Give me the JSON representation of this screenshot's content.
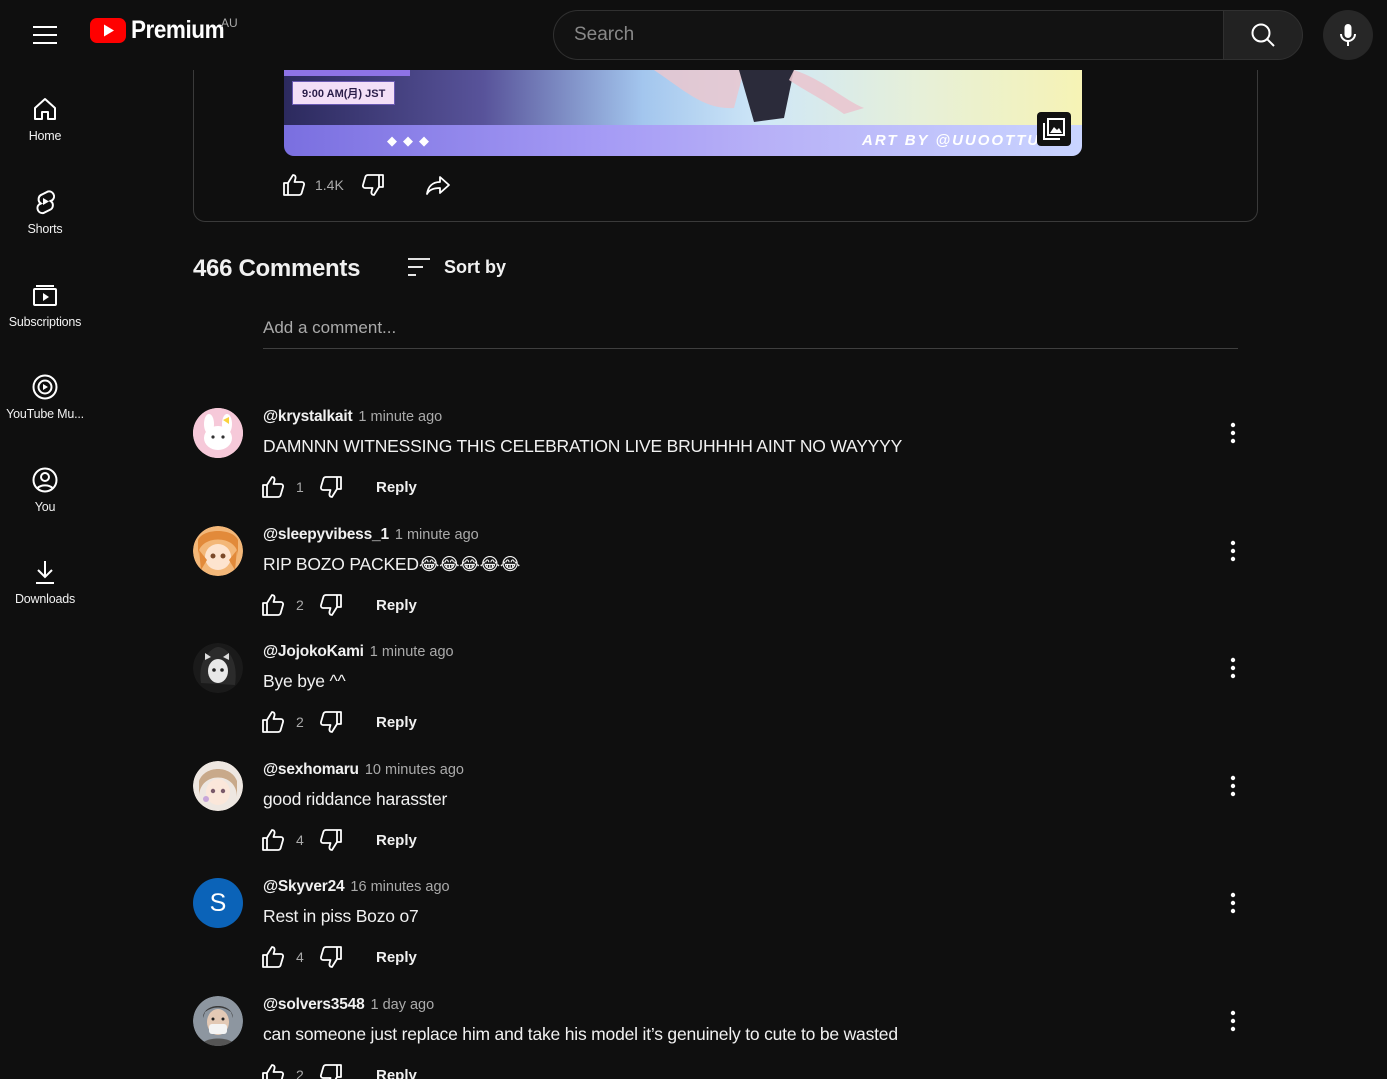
{
  "header": {
    "logo_text": "Premium",
    "region": "AU",
    "search_placeholder": "Search"
  },
  "sidebar": {
    "items": [
      {
        "label": "Home",
        "icon": "home-icon"
      },
      {
        "label": "Shorts",
        "icon": "shorts-icon"
      },
      {
        "label": "Subscriptions",
        "icon": "subscriptions-icon"
      },
      {
        "label": "YouTube Mu...",
        "icon": "youtube-music-icon"
      },
      {
        "label": "You",
        "icon": "account-icon"
      },
      {
        "label": "Downloads",
        "icon": "download-icon"
      }
    ]
  },
  "post": {
    "image_time_tag": "9:00 AM(月) JST",
    "image_art_credit": "ART BY @UUOOTTUU",
    "like_count": "1.4K"
  },
  "comments_section": {
    "count_label": "466 Comments",
    "sort_label": "Sort by",
    "add_comment_placeholder": "Add a comment...",
    "comments": [
      {
        "author": "@krystalkait",
        "time": "1 minute ago",
        "text": "DAMNNN WITNESSING THIS CELEBRATION LIVE BRUHHHH AINT NO WAYYYY",
        "likes": "1",
        "reply_label": "Reply"
      },
      {
        "author": "@sleepyvibess_1",
        "time": "1 minute ago",
        "text": "RIP BOZO PACKED😂😂😂😂😂",
        "likes": "2",
        "reply_label": "Reply"
      },
      {
        "author": "@JojokoKami",
        "time": "1 minute ago",
        "text": "Bye bye ^^",
        "likes": "2",
        "reply_label": "Reply"
      },
      {
        "author": "@sexhomaru",
        "time": "10 minutes ago",
        "text": "good riddance harasster",
        "likes": "4",
        "reply_label": "Reply"
      },
      {
        "author": "@Skyver24",
        "time": "16 minutes ago",
        "text": "Rest in piss Bozo o7",
        "likes": "4",
        "reply_label": "Reply",
        "avatar_letter": "S"
      },
      {
        "author": "@solvers3548",
        "time": "1 day ago",
        "text": "can someone just replace him and take his model it’s genuinely to cute to be wasted",
        "likes": "2",
        "reply_label": "Reply"
      }
    ]
  },
  "colors": {
    "background": "#0f0f0f",
    "brand_red": "#ff0000",
    "avatar_s_blue": "#0b63b8"
  }
}
